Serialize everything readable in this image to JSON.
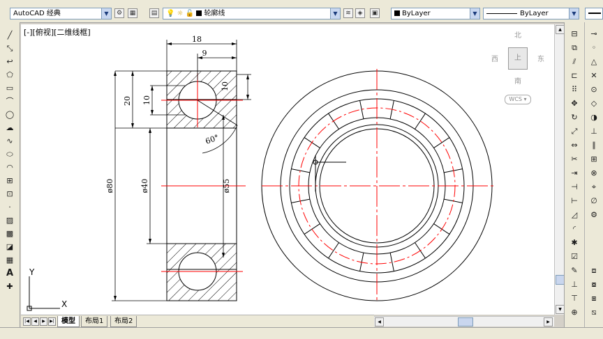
{
  "toolbar": {
    "workspace": "AutoCAD 经典",
    "layer": "轮廓线",
    "color": "ByLayer",
    "linetype": "ByLayer"
  },
  "viewport": {
    "label": "[-][俯视][二维线框]"
  },
  "viewcube": {
    "north": "北",
    "south": "南",
    "east": "东",
    "west": "西",
    "face": "上",
    "wcs": "WCS"
  },
  "ucs": {
    "x": "X",
    "y": "Y"
  },
  "drawing": {
    "dim_18": "18",
    "dim_9": "9",
    "dim_20": "20",
    "dim_10a": "10",
    "dim_10b": "10",
    "dim_angle": "60°",
    "dim_phi80": "ø80",
    "dim_phi40": "ø40",
    "dim_phi55": "ø55"
  },
  "tabs": [
    "模型",
    "布局1",
    "布局2"
  ],
  "colors": {
    "centerline": "#ff0000",
    "geometry": "#000000",
    "canvas": "#ffffff"
  }
}
